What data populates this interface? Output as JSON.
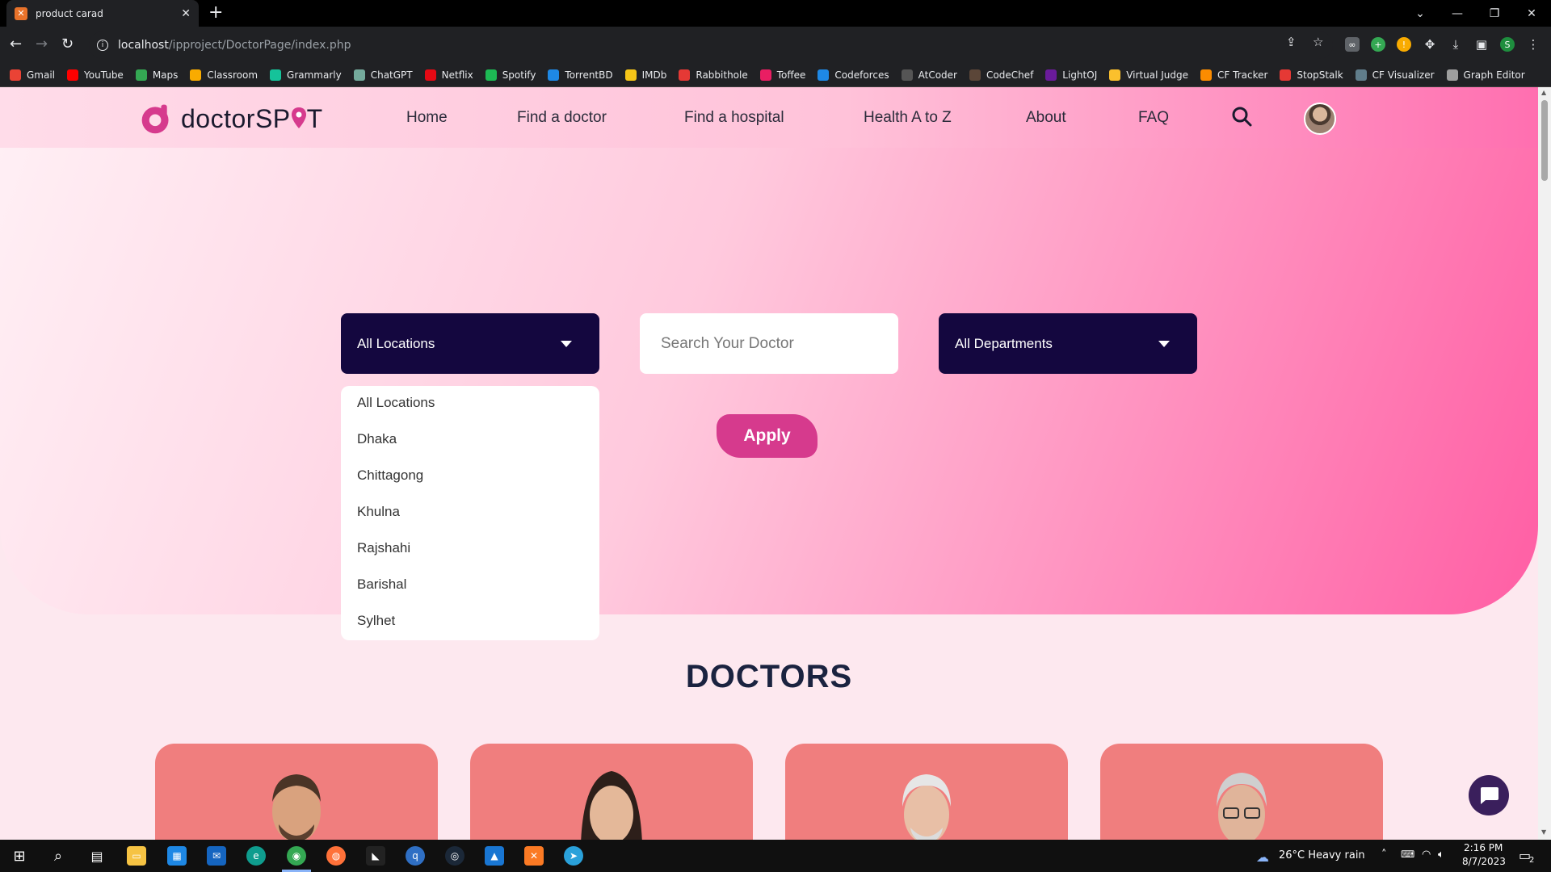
{
  "browser": {
    "tab_title": "product carad",
    "tab_favicon": "xampp-icon",
    "url_host": "localhost",
    "url_path": "/ipproject/DoctorPage/index.php",
    "bookmarks": [
      {
        "label": "Gmail",
        "icon": "gmail-icon",
        "color": "#ea4335"
      },
      {
        "label": "YouTube",
        "icon": "youtube-icon",
        "color": "#ff0000"
      },
      {
        "label": "Maps",
        "icon": "maps-icon",
        "color": "#34a853"
      },
      {
        "label": "Classroom",
        "icon": "classroom-icon",
        "color": "#f9ab00"
      },
      {
        "label": "Grammarly",
        "icon": "grammarly-icon",
        "color": "#15c39a"
      },
      {
        "label": "ChatGPT",
        "icon": "chatgpt-icon",
        "color": "#74aa9c"
      },
      {
        "label": "Netflix",
        "icon": "netflix-icon",
        "color": "#e50914"
      },
      {
        "label": "Spotify",
        "icon": "spotify-icon",
        "color": "#1db954"
      },
      {
        "label": "TorrentBD",
        "icon": "torrentbd-icon",
        "color": "#1e88e5"
      },
      {
        "label": "IMDb",
        "icon": "imdb-icon",
        "color": "#f5c518"
      },
      {
        "label": "Rabbithole",
        "icon": "rabbithole-icon",
        "color": "#e53935"
      },
      {
        "label": "Toffee",
        "icon": "toffee-icon",
        "color": "#e91e63"
      },
      {
        "label": "Codeforces",
        "icon": "codeforces-icon",
        "color": "#1e88e5"
      },
      {
        "label": "AtCoder",
        "icon": "atcoder-icon",
        "color": "#555555"
      },
      {
        "label": "CodeChef",
        "icon": "codechef-icon",
        "color": "#5b4638"
      },
      {
        "label": "LightOJ",
        "icon": "lightoj-icon",
        "color": "#6a1b9a"
      },
      {
        "label": "Virtual Judge",
        "icon": "vjudge-icon",
        "color": "#fbc02d"
      },
      {
        "label": "CF Tracker",
        "icon": "cftracker-icon",
        "color": "#fb8c00"
      },
      {
        "label": "StopStalk",
        "icon": "stopstalk-icon",
        "color": "#e53935"
      },
      {
        "label": "CF Visualizer",
        "icon": "cfvisualizer-icon",
        "color": "#607d8b"
      },
      {
        "label": "Graph Editor",
        "icon": "grapheditor-icon",
        "color": "#9e9e9e"
      }
    ]
  },
  "site": {
    "logo_text_prefix": "doctorSP",
    "logo_text_suffix": "T",
    "brand_color": "#d63a8d",
    "nav": [
      {
        "label": "Home"
      },
      {
        "label": "Find a doctor"
      },
      {
        "label": "Find a hospital"
      },
      {
        "label": "Health A to Z"
      },
      {
        "label": "About"
      },
      {
        "label": "FAQ"
      }
    ]
  },
  "filters": {
    "location_selected": "All Locations",
    "search_placeholder": "Search Your Doctor",
    "department_selected": "All Departments",
    "location_options": [
      "All Locations",
      "Dhaka",
      "Chittagong",
      "Khulna",
      "Rajshahi",
      "Barishal",
      "Sylhet"
    ],
    "apply_label": "Apply"
  },
  "doctors_section": {
    "title": "DOCTORS",
    "card_color": "#f07e7e"
  },
  "taskbar": {
    "weather": "26°C  Heavy rain",
    "time": "2:16 PM",
    "date": "8/7/2023",
    "notification_count": "2"
  }
}
